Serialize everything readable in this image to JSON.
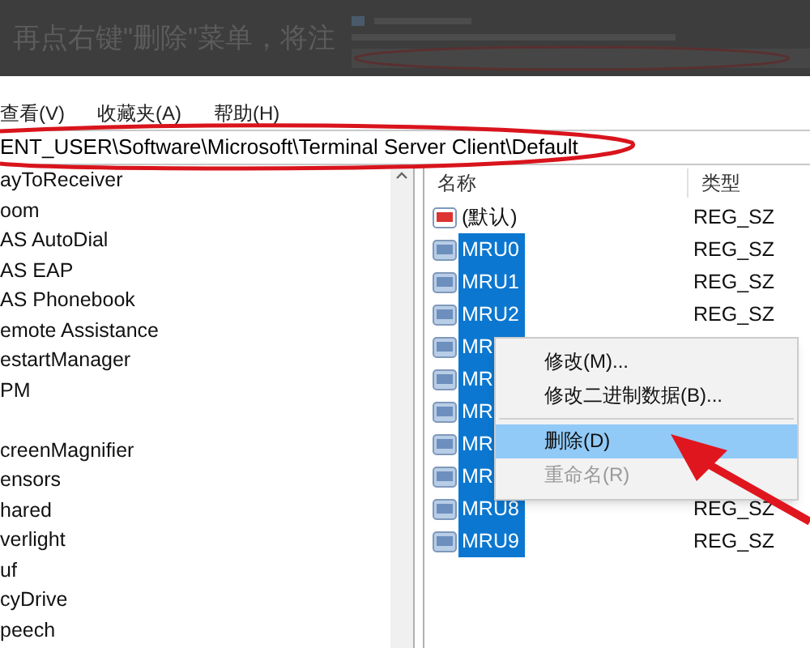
{
  "caption": "再点右键\"删除\"菜单，将注",
  "menu_bar": [
    "查看(V)",
    "收藏夹(A)",
    "帮助(H)"
  ],
  "address": "ENT_USER\\Software\\Microsoft\\Terminal Server Client\\Default",
  "tree_items": [
    {
      "label": "ayToReceiver"
    },
    {
      "label": "oom"
    },
    {
      "label": "AS AutoDial"
    },
    {
      "label": "AS EAP"
    },
    {
      "label": "AS Phonebook"
    },
    {
      "label": "emote Assistance"
    },
    {
      "label": "estartManager"
    },
    {
      "label": "PM"
    },
    {
      "label": "creenMagnifier",
      "gap_before": true
    },
    {
      "label": "ensors"
    },
    {
      "label": "hared"
    },
    {
      "label": "verlight"
    },
    {
      "label": "uf"
    },
    {
      "label": "cyDrive"
    },
    {
      "label": "peech"
    }
  ],
  "columns": [
    "名称",
    "类型"
  ],
  "values": [
    {
      "name": "(默认)",
      "type": "REG_SZ",
      "selected": false
    },
    {
      "name": "MRU0",
      "type": "REG_SZ",
      "selected": true
    },
    {
      "name": "MRU1",
      "type": "REG_SZ",
      "selected": true
    },
    {
      "name": "MRU2",
      "type": "REG_SZ",
      "selected": true
    },
    {
      "name": "MR",
      "selected": true
    },
    {
      "name": "MR",
      "selected": true
    },
    {
      "name": "MR",
      "selected": true
    },
    {
      "name": "MR",
      "selected": true
    },
    {
      "name": "MR",
      "selected": true
    },
    {
      "name": "MRU8",
      "type": "REG_SZ",
      "selected": true
    },
    {
      "name": "MRU9",
      "type": "REG_SZ",
      "selected": true
    }
  ],
  "context_menu": [
    {
      "kind": "item",
      "label": "修改(M)...",
      "selected": false,
      "disabled": false
    },
    {
      "kind": "item",
      "label": "修改二进制数据(B)...",
      "selected": false,
      "disabled": false
    },
    {
      "kind": "separator"
    },
    {
      "kind": "item",
      "label": "删除(D)",
      "selected": true,
      "disabled": false
    },
    {
      "kind": "item",
      "label": "重命名(R)",
      "selected": false,
      "disabled": true
    }
  ]
}
